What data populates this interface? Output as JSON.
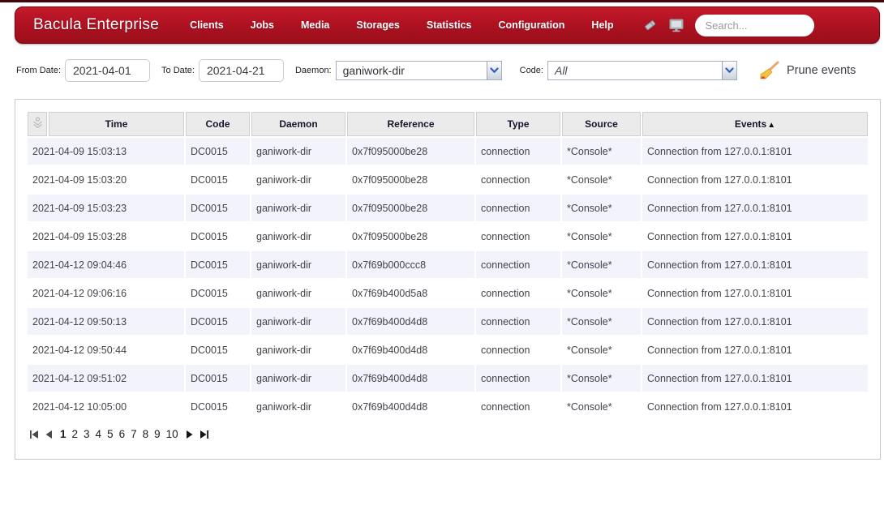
{
  "header": {
    "brand": "Bacula Enterprise",
    "nav_items": [
      {
        "label": "Clients"
      },
      {
        "label": "Jobs"
      },
      {
        "label": "Media"
      },
      {
        "label": "Storages"
      },
      {
        "label": "Statistics"
      },
      {
        "label": "Configuration"
      },
      {
        "label": "Help"
      }
    ],
    "icons": [
      {
        "name": "label-icon"
      },
      {
        "name": "monitor-icon"
      }
    ],
    "search": {
      "placeholder": "Search..."
    }
  },
  "filters": {
    "from_date_label": "From Date:",
    "from_date_value": "2021-04-01",
    "to_date_label": "To Date:",
    "to_date_value": "2021-04-21",
    "daemon_label": "Daemon:",
    "daemon_value": "ganiwork-dir",
    "code_label": "Code:",
    "code_value": "All",
    "prune_button_label": "Prune events",
    "prune_icon": "broom-icon"
  },
  "table": {
    "columns": [
      "Time",
      "Code",
      "Daemon",
      "Reference",
      "Type",
      "Source",
      "Events"
    ],
    "sort": {
      "column": "Events",
      "direction": "asc",
      "indicator": "▲"
    },
    "corner_icon": "download-anchor-icon",
    "rows": [
      {
        "time": "2021-04-09 15:03:13",
        "code": "DC0015",
        "daemon": "ganiwork-dir",
        "reference": "0x7f095000be28",
        "type": "connection",
        "source": "*Console*",
        "events": "Connection from 127.0.0.1:8101"
      },
      {
        "time": "2021-04-09 15:03:20",
        "code": "DC0015",
        "daemon": "ganiwork-dir",
        "reference": "0x7f095000be28",
        "type": "connection",
        "source": "*Console*",
        "events": "Connection from 127.0.0.1:8101"
      },
      {
        "time": "2021-04-09 15:03:23",
        "code": "DC0015",
        "daemon": "ganiwork-dir",
        "reference": "0x7f095000be28",
        "type": "connection",
        "source": "*Console*",
        "events": "Connection from 127.0.0.1:8101"
      },
      {
        "time": "2021-04-09 15:03:28",
        "code": "DC0015",
        "daemon": "ganiwork-dir",
        "reference": "0x7f095000be28",
        "type": "connection",
        "source": "*Console*",
        "events": "Connection from 127.0.0.1:8101"
      },
      {
        "time": "2021-04-12 09:04:46",
        "code": "DC0015",
        "daemon": "ganiwork-dir",
        "reference": "0x7f69b000ccc8",
        "type": "connection",
        "source": "*Console*",
        "events": "Connection from 127.0.0.1:8101"
      },
      {
        "time": "2021-04-12 09:06:16",
        "code": "DC0015",
        "daemon": "ganiwork-dir",
        "reference": "0x7f69b400d5a8",
        "type": "connection",
        "source": "*Console*",
        "events": "Connection from 127.0.0.1:8101"
      },
      {
        "time": "2021-04-12 09:50:13",
        "code": "DC0015",
        "daemon": "ganiwork-dir",
        "reference": "0x7f69b400d4d8",
        "type": "connection",
        "source": "*Console*",
        "events": "Connection from 127.0.0.1:8101"
      },
      {
        "time": "2021-04-12 09:50:44",
        "code": "DC0015",
        "daemon": "ganiwork-dir",
        "reference": "0x7f69b400d4d8",
        "type": "connection",
        "source": "*Console*",
        "events": "Connection from 127.0.0.1:8101"
      },
      {
        "time": "2021-04-12 09:51:02",
        "code": "DC0015",
        "daemon": "ganiwork-dir",
        "reference": "0x7f69b400d4d8",
        "type": "connection",
        "source": "*Console*",
        "events": "Connection from 127.0.0.1:8101"
      },
      {
        "time": "2021-04-12 10:05:00",
        "code": "DC0015",
        "daemon": "ganiwork-dir",
        "reference": "0x7f69b400d4d8",
        "type": "connection",
        "source": "*Console*",
        "events": "Connection from 127.0.0.1:8101"
      }
    ]
  },
  "pagination": {
    "pages": [
      "1",
      "2",
      "3",
      "4",
      "5",
      "6",
      "7",
      "8",
      "9",
      "10"
    ],
    "current_page": "1",
    "controls": [
      "first-page-icon",
      "previous-page-icon",
      "next-page-icon",
      "last-page-icon"
    ]
  },
  "colors": {
    "header_red": "#b01222",
    "header_red_dark": "#9a0e1b",
    "header_border": "#6e0a12",
    "row_stripe": "#f3f3fb",
    "header_cell_bg": "#ebebeb",
    "combo_chevron_blue": "#2f5fbf"
  }
}
